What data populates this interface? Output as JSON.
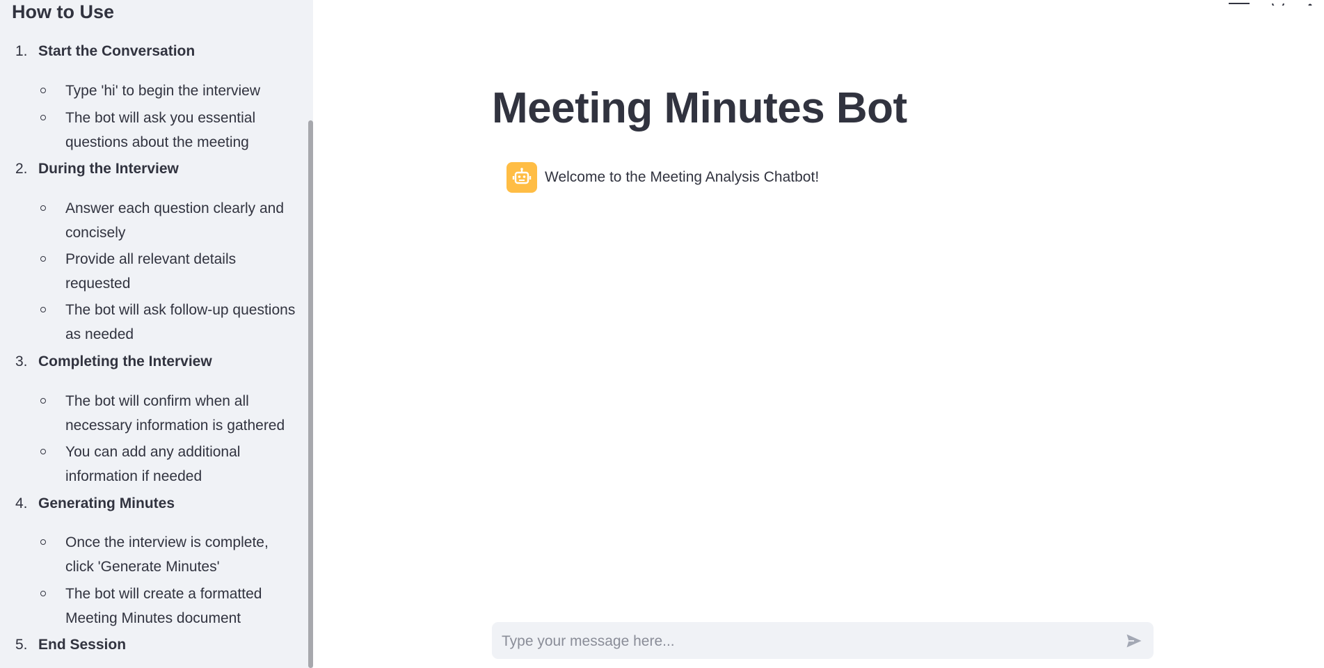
{
  "sidebar": {
    "heading": "How to Use",
    "steps": [
      {
        "num": "1.",
        "title": "Start the Conversation",
        "items": [
          {
            "line1": "Type 'hi' to begin the interview",
            "line2": ""
          },
          {
            "line1": "The bot will ask you essential",
            "line2": "questions about the meeting"
          }
        ]
      },
      {
        "num": "2.",
        "title": "During the Interview",
        "items": [
          {
            "line1": "Answer each question clearly and",
            "line2": "concisely"
          },
          {
            "line1": "Provide all relevant details",
            "line2": "requested"
          },
          {
            "line1": "The bot will ask follow-up questions",
            "line2": "as needed"
          }
        ]
      },
      {
        "num": "3.",
        "title": "Completing the Interview",
        "items": [
          {
            "line1": "The bot will confirm when all",
            "line2": "necessary information is gathered"
          },
          {
            "line1": "You can add any additional",
            "line2": "information if needed"
          }
        ]
      },
      {
        "num": "4.",
        "title": "Generating Minutes",
        "items": [
          {
            "line1": "Once the interview is complete,",
            "line2": "click 'Generate Minutes'"
          },
          {
            "line1": "The bot will create a formatted",
            "line2": "Meeting Minutes document"
          }
        ]
      },
      {
        "num": "5.",
        "title": "End Session",
        "items": []
      }
    ]
  },
  "main": {
    "title": "Meeting Minutes Bot",
    "messages": [
      {
        "role": "assistant",
        "avatar_icon": "robot-icon",
        "text": "Welcome to the Meeting Analysis Chatbot!"
      }
    ],
    "chat_input": {
      "placeholder": "Type your message here...",
      "value": ""
    }
  },
  "colors": {
    "sidebar_bg": "#f0f2f6",
    "text": "#31333f",
    "avatar_bg": "#ffbd45",
    "input_bg": "#f0f2f6",
    "send_icon": "#a3a8b4"
  }
}
